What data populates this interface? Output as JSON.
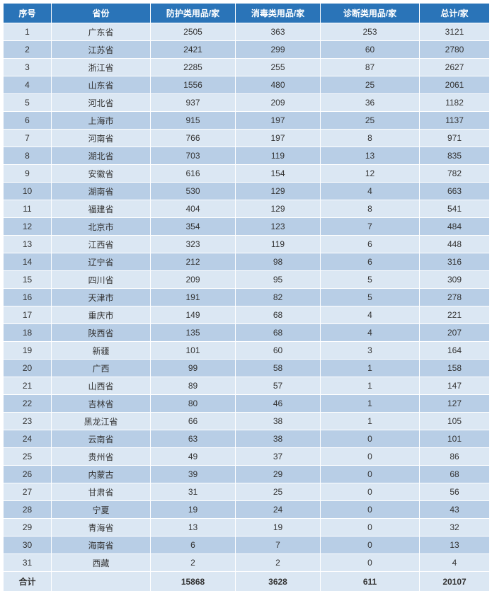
{
  "headers": {
    "seq": "序号",
    "province": "省份",
    "protect": "防护类用品/家",
    "disinfect": "消毒类用品/家",
    "diagnose": "诊断类用品/家",
    "total": "总计/家"
  },
  "rows": [
    {
      "seq": "1",
      "province": "广东省",
      "protect": "2505",
      "disinfect": "363",
      "diagnose": "253",
      "total": "3121"
    },
    {
      "seq": "2",
      "province": "江苏省",
      "protect": "2421",
      "disinfect": "299",
      "diagnose": "60",
      "total": "2780"
    },
    {
      "seq": "3",
      "province": "浙江省",
      "protect": "2285",
      "disinfect": "255",
      "diagnose": "87",
      "total": "2627"
    },
    {
      "seq": "4",
      "province": "山东省",
      "protect": "1556",
      "disinfect": "480",
      "diagnose": "25",
      "total": "2061"
    },
    {
      "seq": "5",
      "province": "河北省",
      "protect": "937",
      "disinfect": "209",
      "diagnose": "36",
      "total": "1182"
    },
    {
      "seq": "6",
      "province": "上海市",
      "protect": "915",
      "disinfect": "197",
      "diagnose": "25",
      "total": "1137"
    },
    {
      "seq": "7",
      "province": "河南省",
      "protect": "766",
      "disinfect": "197",
      "diagnose": "8",
      "total": "971"
    },
    {
      "seq": "8",
      "province": "湖北省",
      "protect": "703",
      "disinfect": "119",
      "diagnose": "13",
      "total": "835"
    },
    {
      "seq": "9",
      "province": "安徽省",
      "protect": "616",
      "disinfect": "154",
      "diagnose": "12",
      "total": "782"
    },
    {
      "seq": "10",
      "province": "湖南省",
      "protect": "530",
      "disinfect": "129",
      "diagnose": "4",
      "total": "663"
    },
    {
      "seq": "11",
      "province": "福建省",
      "protect": "404",
      "disinfect": "129",
      "diagnose": "8",
      "total": "541"
    },
    {
      "seq": "12",
      "province": "北京市",
      "protect": "354",
      "disinfect": "123",
      "diagnose": "7",
      "total": "484"
    },
    {
      "seq": "13",
      "province": "江西省",
      "protect": "323",
      "disinfect": "119",
      "diagnose": "6",
      "total": "448"
    },
    {
      "seq": "14",
      "province": "辽宁省",
      "protect": "212",
      "disinfect": "98",
      "diagnose": "6",
      "total": "316"
    },
    {
      "seq": "15",
      "province": "四川省",
      "protect": "209",
      "disinfect": "95",
      "diagnose": "5",
      "total": "309"
    },
    {
      "seq": "16",
      "province": "天津市",
      "protect": "191",
      "disinfect": "82",
      "diagnose": "5",
      "total": "278"
    },
    {
      "seq": "17",
      "province": "重庆市",
      "protect": "149",
      "disinfect": "68",
      "diagnose": "4",
      "total": "221"
    },
    {
      "seq": "18",
      "province": "陕西省",
      "protect": "135",
      "disinfect": "68",
      "diagnose": "4",
      "total": "207"
    },
    {
      "seq": "19",
      "province": "新疆",
      "protect": "101",
      "disinfect": "60",
      "diagnose": "3",
      "total": "164"
    },
    {
      "seq": "20",
      "province": "广西",
      "protect": "99",
      "disinfect": "58",
      "diagnose": "1",
      "total": "158"
    },
    {
      "seq": "21",
      "province": "山西省",
      "protect": "89",
      "disinfect": "57",
      "diagnose": "1",
      "total": "147"
    },
    {
      "seq": "22",
      "province": "吉林省",
      "protect": "80",
      "disinfect": "46",
      "diagnose": "1",
      "total": "127"
    },
    {
      "seq": "23",
      "province": "黑龙江省",
      "protect": "66",
      "disinfect": "38",
      "diagnose": "1",
      "total": "105"
    },
    {
      "seq": "24",
      "province": "云南省",
      "protect": "63",
      "disinfect": "38",
      "diagnose": "0",
      "total": "101"
    },
    {
      "seq": "25",
      "province": "贵州省",
      "protect": "49",
      "disinfect": "37",
      "diagnose": "0",
      "total": "86"
    },
    {
      "seq": "26",
      "province": "内蒙古",
      "protect": "39",
      "disinfect": "29",
      "diagnose": "0",
      "total": "68"
    },
    {
      "seq": "27",
      "province": "甘肃省",
      "protect": "31",
      "disinfect": "25",
      "diagnose": "0",
      "total": "56"
    },
    {
      "seq": "28",
      "province": "宁夏",
      "protect": "19",
      "disinfect": "24",
      "diagnose": "0",
      "total": "43"
    },
    {
      "seq": "29",
      "province": "青海省",
      "protect": "13",
      "disinfect": "19",
      "diagnose": "0",
      "total": "32"
    },
    {
      "seq": "30",
      "province": "海南省",
      "protect": "6",
      "disinfect": "7",
      "diagnose": "0",
      "total": "13"
    },
    {
      "seq": "31",
      "province": "西藏",
      "protect": "2",
      "disinfect": "2",
      "diagnose": "0",
      "total": "4"
    }
  ],
  "footer": {
    "label": "合计",
    "province": "",
    "protect": "15868",
    "disinfect": "3628",
    "diagnose": "611",
    "total": "20107"
  }
}
